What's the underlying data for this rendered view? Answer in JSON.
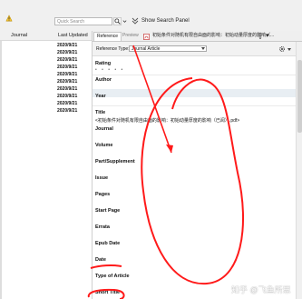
{
  "toolbar": {
    "search_placeholder": "Quick Search",
    "show_panel_label": "Show Search Panel"
  },
  "library": {
    "columns": {
      "journal": "Journal",
      "last_updated": "Last Updated"
    },
    "rows": [
      "2020/9/21",
      "2020/9/21",
      "2020/9/21",
      "2020/9/21",
      "2020/9/21",
      "2020/9/21",
      "2020/9/21",
      "2020/9/21",
      "2020/9/21",
      "2020/9/21"
    ]
  },
  "panel": {
    "tabs": {
      "reference": "Reference",
      "preview": "Preview"
    },
    "pdf_title": "初始条件对随机有限自由面的影响：初始动量厚度的影响（...",
    "menu": "▾",
    "reference_type_label": "Reference Type:",
    "reference_type_value": "Journal Article",
    "fields": {
      "rating": "Rating",
      "author": "Author",
      "year": "Year",
      "title": "Title",
      "title_value": "<初始条件对随机有限自由面的影响：初始动量厚度的影响（已阅）.pdf>",
      "journal": "Journal",
      "volume": "Volume",
      "part_supplement": "Part/Supplement",
      "issue": "Issue",
      "pages": "Pages",
      "start_page": "Start Page",
      "errata": "Errata",
      "epub_date": "Epub Date",
      "date": "Date",
      "type_of_article": "Type of Article",
      "short_title": "Short Title"
    }
  },
  "watermark": "知乎 @飞鱼所思",
  "colors": {
    "annotation": "#ff1a1a",
    "accent": "#2a64a8"
  }
}
